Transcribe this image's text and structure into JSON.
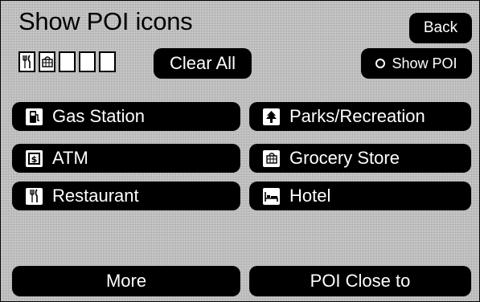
{
  "header": {
    "title": "Show POI icons",
    "back_label": "Back"
  },
  "selection": {
    "slots": [
      {
        "icon": "restaurant-icon",
        "filled": true
      },
      {
        "icon": "grocery-store-icon",
        "filled": true
      },
      {
        "icon": "",
        "filled": false
      },
      {
        "icon": "",
        "filled": false
      },
      {
        "icon": "",
        "filled": false
      }
    ],
    "clear_all_label": "Clear All",
    "show_poi_label": "Show POI"
  },
  "categories": {
    "gas_station": {
      "label": "Gas Station",
      "icon": "gas-pump-icon"
    },
    "parks": {
      "label": "Parks/Recreation",
      "icon": "parks-recreation-icon"
    },
    "atm": {
      "label": "ATM",
      "icon": "atm-icon"
    },
    "grocery": {
      "label": "Grocery Store",
      "icon": "grocery-store-icon"
    },
    "restaurant": {
      "label": "Restaurant",
      "icon": "restaurant-icon"
    },
    "hotel": {
      "label": "Hotel",
      "icon": "hotel-icon"
    }
  },
  "footer": {
    "more_label": "More",
    "close_to_label": "POI Close to"
  }
}
